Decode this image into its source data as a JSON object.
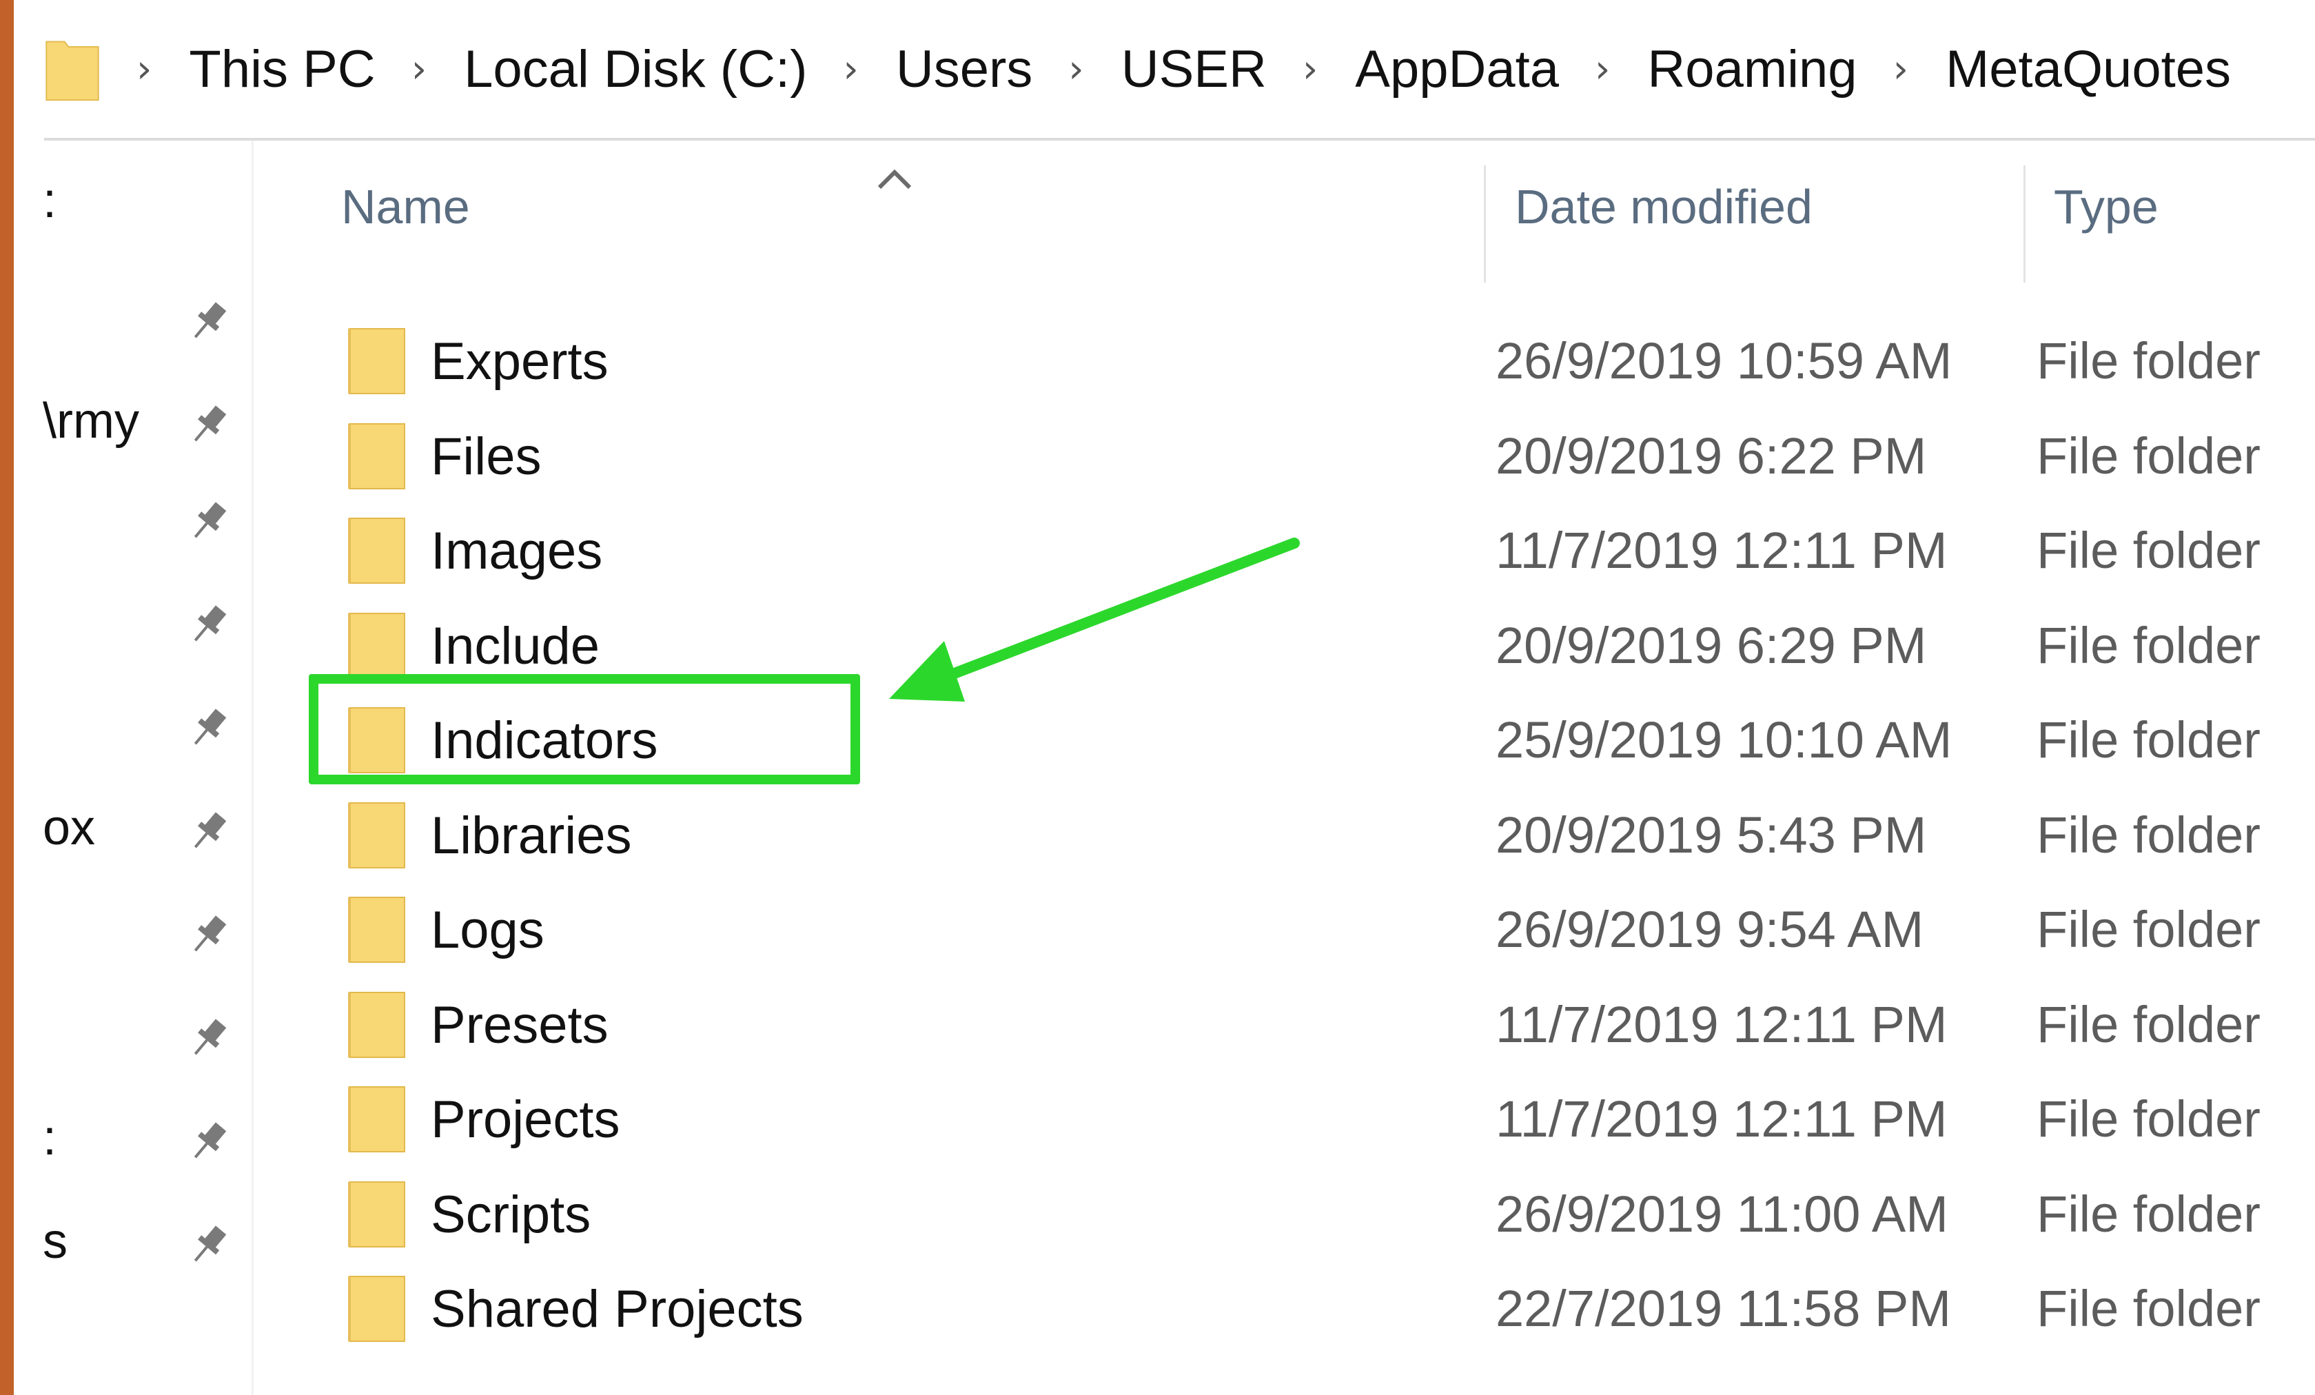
{
  "window": {
    "accent_color": "#c2622a",
    "annotation_color": "#2cd72c",
    "folder_color": "#f8d775"
  },
  "address_bar": {
    "root_icon": "folder-icon",
    "separator": "›",
    "crumbs": [
      "This PC",
      "Local Disk (C:)",
      "Users",
      "USER",
      "AppData",
      "Roaming",
      "MetaQuotes"
    ]
  },
  "nav_pane": {
    "items": [
      {
        "label": ":",
        "pinned": false
      },
      {
        "label": "",
        "pinned": true
      },
      {
        "label": "\\rmy",
        "pinned": true
      },
      {
        "label": "",
        "pinned": true
      },
      {
        "label": "",
        "pinned": true
      },
      {
        "label": "",
        "pinned": true
      },
      {
        "label": "ox",
        "pinned": true
      },
      {
        "label": "",
        "pinned": true
      },
      {
        "label": "",
        "pinned": true
      },
      {
        "label": ":",
        "pinned": true
      },
      {
        "label": "s",
        "pinned": true
      }
    ]
  },
  "columns": {
    "name": "Name",
    "date_modified": "Date modified",
    "type": "Type",
    "sort_indicator": "ascending"
  },
  "files": [
    {
      "name": "Experts",
      "date": "26/9/2019 10:59 AM",
      "type": "File folder"
    },
    {
      "name": "Files",
      "date": "20/9/2019 6:22 PM",
      "type": "File folder"
    },
    {
      "name": "Images",
      "date": "11/7/2019 12:11 PM",
      "type": "File folder"
    },
    {
      "name": "Include",
      "date": "20/9/2019 6:29 PM",
      "type": "File folder"
    },
    {
      "name": "Indicators",
      "date": "25/9/2019 10:10 AM",
      "type": "File folder",
      "highlighted": true
    },
    {
      "name": "Libraries",
      "date": "20/9/2019 5:43 PM",
      "type": "File folder"
    },
    {
      "name": "Logs",
      "date": "26/9/2019 9:54 AM",
      "type": "File folder"
    },
    {
      "name": "Presets",
      "date": "11/7/2019 12:11 PM",
      "type": "File folder"
    },
    {
      "name": "Projects",
      "date": "11/7/2019 12:11 PM",
      "type": "File folder"
    },
    {
      "name": "Scripts",
      "date": "26/9/2019 11:00 AM",
      "type": "File folder"
    },
    {
      "name": "Shared Projects",
      "date": "22/7/2019 11:58 PM",
      "type": "File folder"
    }
  ]
}
